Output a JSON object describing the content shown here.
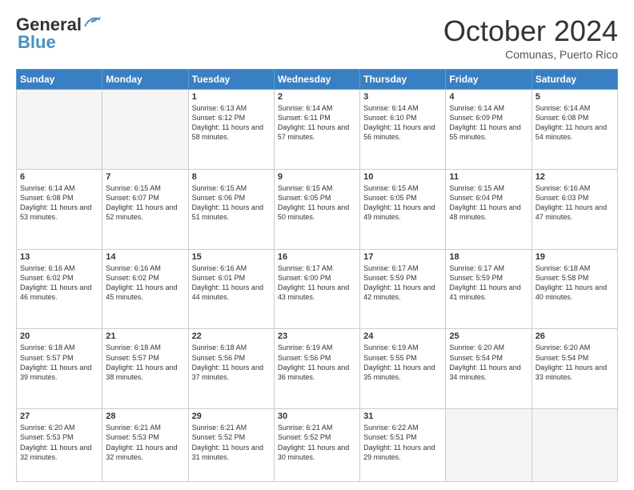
{
  "header": {
    "logo_line1": "General",
    "logo_line2": "Blue",
    "month": "October 2024",
    "location": "Comunas, Puerto Rico"
  },
  "weekdays": [
    "Sunday",
    "Monday",
    "Tuesday",
    "Wednesday",
    "Thursday",
    "Friday",
    "Saturday"
  ],
  "rows": [
    [
      {
        "day": "",
        "sunrise": "",
        "sunset": "",
        "daylight": ""
      },
      {
        "day": "",
        "sunrise": "",
        "sunset": "",
        "daylight": ""
      },
      {
        "day": "1",
        "sunrise": "Sunrise: 6:13 AM",
        "sunset": "Sunset: 6:12 PM",
        "daylight": "Daylight: 11 hours and 58 minutes."
      },
      {
        "day": "2",
        "sunrise": "Sunrise: 6:14 AM",
        "sunset": "Sunset: 6:11 PM",
        "daylight": "Daylight: 11 hours and 57 minutes."
      },
      {
        "day": "3",
        "sunrise": "Sunrise: 6:14 AM",
        "sunset": "Sunset: 6:10 PM",
        "daylight": "Daylight: 11 hours and 56 minutes."
      },
      {
        "day": "4",
        "sunrise": "Sunrise: 6:14 AM",
        "sunset": "Sunset: 6:09 PM",
        "daylight": "Daylight: 11 hours and 55 minutes."
      },
      {
        "day": "5",
        "sunrise": "Sunrise: 6:14 AM",
        "sunset": "Sunset: 6:08 PM",
        "daylight": "Daylight: 11 hours and 54 minutes."
      }
    ],
    [
      {
        "day": "6",
        "sunrise": "Sunrise: 6:14 AM",
        "sunset": "Sunset: 6:08 PM",
        "daylight": "Daylight: 11 hours and 53 minutes."
      },
      {
        "day": "7",
        "sunrise": "Sunrise: 6:15 AM",
        "sunset": "Sunset: 6:07 PM",
        "daylight": "Daylight: 11 hours and 52 minutes."
      },
      {
        "day": "8",
        "sunrise": "Sunrise: 6:15 AM",
        "sunset": "Sunset: 6:06 PM",
        "daylight": "Daylight: 11 hours and 51 minutes."
      },
      {
        "day": "9",
        "sunrise": "Sunrise: 6:15 AM",
        "sunset": "Sunset: 6:05 PM",
        "daylight": "Daylight: 11 hours and 50 minutes."
      },
      {
        "day": "10",
        "sunrise": "Sunrise: 6:15 AM",
        "sunset": "Sunset: 6:05 PM",
        "daylight": "Daylight: 11 hours and 49 minutes."
      },
      {
        "day": "11",
        "sunrise": "Sunrise: 6:15 AM",
        "sunset": "Sunset: 6:04 PM",
        "daylight": "Daylight: 11 hours and 48 minutes."
      },
      {
        "day": "12",
        "sunrise": "Sunrise: 6:16 AM",
        "sunset": "Sunset: 6:03 PM",
        "daylight": "Daylight: 11 hours and 47 minutes."
      }
    ],
    [
      {
        "day": "13",
        "sunrise": "Sunrise: 6:16 AM",
        "sunset": "Sunset: 6:02 PM",
        "daylight": "Daylight: 11 hours and 46 minutes."
      },
      {
        "day": "14",
        "sunrise": "Sunrise: 6:16 AM",
        "sunset": "Sunset: 6:02 PM",
        "daylight": "Daylight: 11 hours and 45 minutes."
      },
      {
        "day": "15",
        "sunrise": "Sunrise: 6:16 AM",
        "sunset": "Sunset: 6:01 PM",
        "daylight": "Daylight: 11 hours and 44 minutes."
      },
      {
        "day": "16",
        "sunrise": "Sunrise: 6:17 AM",
        "sunset": "Sunset: 6:00 PM",
        "daylight": "Daylight: 11 hours and 43 minutes."
      },
      {
        "day": "17",
        "sunrise": "Sunrise: 6:17 AM",
        "sunset": "Sunset: 5:59 PM",
        "daylight": "Daylight: 11 hours and 42 minutes."
      },
      {
        "day": "18",
        "sunrise": "Sunrise: 6:17 AM",
        "sunset": "Sunset: 5:59 PM",
        "daylight": "Daylight: 11 hours and 41 minutes."
      },
      {
        "day": "19",
        "sunrise": "Sunrise: 6:18 AM",
        "sunset": "Sunset: 5:58 PM",
        "daylight": "Daylight: 11 hours and 40 minutes."
      }
    ],
    [
      {
        "day": "20",
        "sunrise": "Sunrise: 6:18 AM",
        "sunset": "Sunset: 5:57 PM",
        "daylight": "Daylight: 11 hours and 39 minutes."
      },
      {
        "day": "21",
        "sunrise": "Sunrise: 6:18 AM",
        "sunset": "Sunset: 5:57 PM",
        "daylight": "Daylight: 11 hours and 38 minutes."
      },
      {
        "day": "22",
        "sunrise": "Sunrise: 6:18 AM",
        "sunset": "Sunset: 5:56 PM",
        "daylight": "Daylight: 11 hours and 37 minutes."
      },
      {
        "day": "23",
        "sunrise": "Sunrise: 6:19 AM",
        "sunset": "Sunset: 5:56 PM",
        "daylight": "Daylight: 11 hours and 36 minutes."
      },
      {
        "day": "24",
        "sunrise": "Sunrise: 6:19 AM",
        "sunset": "Sunset: 5:55 PM",
        "daylight": "Daylight: 11 hours and 35 minutes."
      },
      {
        "day": "25",
        "sunrise": "Sunrise: 6:20 AM",
        "sunset": "Sunset: 5:54 PM",
        "daylight": "Daylight: 11 hours and 34 minutes."
      },
      {
        "day": "26",
        "sunrise": "Sunrise: 6:20 AM",
        "sunset": "Sunset: 5:54 PM",
        "daylight": "Daylight: 11 hours and 33 minutes."
      }
    ],
    [
      {
        "day": "27",
        "sunrise": "Sunrise: 6:20 AM",
        "sunset": "Sunset: 5:53 PM",
        "daylight": "Daylight: 11 hours and 32 minutes."
      },
      {
        "day": "28",
        "sunrise": "Sunrise: 6:21 AM",
        "sunset": "Sunset: 5:53 PM",
        "daylight": "Daylight: 11 hours and 32 minutes."
      },
      {
        "day": "29",
        "sunrise": "Sunrise: 6:21 AM",
        "sunset": "Sunset: 5:52 PM",
        "daylight": "Daylight: 11 hours and 31 minutes."
      },
      {
        "day": "30",
        "sunrise": "Sunrise: 6:21 AM",
        "sunset": "Sunset: 5:52 PM",
        "daylight": "Daylight: 11 hours and 30 minutes."
      },
      {
        "day": "31",
        "sunrise": "Sunrise: 6:22 AM",
        "sunset": "Sunset: 5:51 PM",
        "daylight": "Daylight: 11 hours and 29 minutes."
      },
      {
        "day": "",
        "sunrise": "",
        "sunset": "",
        "daylight": ""
      },
      {
        "day": "",
        "sunrise": "",
        "sunset": "",
        "daylight": ""
      }
    ]
  ]
}
